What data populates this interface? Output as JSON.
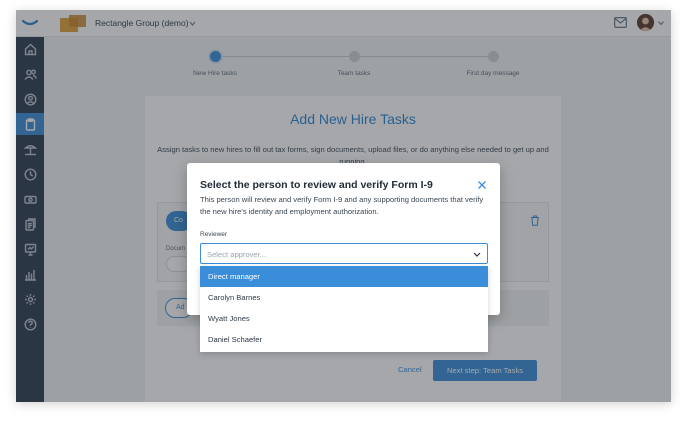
{
  "header": {
    "company_name": "Rectangle Group (demo)"
  },
  "sidebar": {
    "items": [
      {
        "icon": "home-icon"
      },
      {
        "icon": "people-icon"
      },
      {
        "icon": "person-search-icon"
      },
      {
        "icon": "clipboard-icon",
        "active": true
      },
      {
        "icon": "beach-icon"
      },
      {
        "icon": "clock-icon"
      },
      {
        "icon": "money-icon"
      },
      {
        "icon": "documents-icon"
      },
      {
        "icon": "presentation-icon"
      },
      {
        "icon": "bar-chart-icon"
      },
      {
        "icon": "gear-icon"
      },
      {
        "icon": "help-icon"
      }
    ]
  },
  "stepper": {
    "steps": [
      {
        "label": "New Hire tasks",
        "active": true
      },
      {
        "label": "Team tasks",
        "active": false
      },
      {
        "label": "First day message",
        "active": false
      }
    ]
  },
  "card": {
    "title": "Add New Hire Tasks",
    "description": "Assign tasks to new hires to fill out tax forms, sign documents, upload files, or do anything else needed to get up and running.",
    "task_pill": "Co",
    "task_doc_label": "Docum",
    "add_pill": "Ad",
    "cancel_label": "Cancel",
    "next_label": "Next step: Team Tasks"
  },
  "modal": {
    "title": "Select the person to review and verify Form I-9",
    "description": "This person will review and verify Form I-9 and any supporting documents that verify the new hire's identity and employment authorization.",
    "reviewer_label": "Reviewer",
    "reviewer_placeholder": "Select approver...",
    "options": [
      "Direct manager",
      "Carolyn Barnes",
      "Wyatt Jones",
      "Daniel Schaefer"
    ],
    "highlighted_option": "Direct manager"
  },
  "colors": {
    "accent": "#3a8dd8",
    "sidebar": "#2b3d4f",
    "title": "#2d86cf"
  }
}
